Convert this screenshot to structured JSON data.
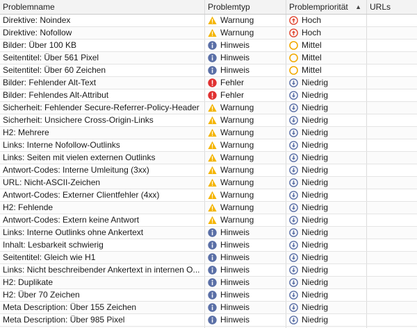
{
  "columns": {
    "name": "Problemname",
    "type": "Problemtyp",
    "priority": "Problempriorität",
    "urls": "URLs"
  },
  "type_icons": {
    "Warnung": "warning-icon",
    "Hinweis": "info-icon",
    "Fehler": "error-icon"
  },
  "priority_icons": {
    "Hoch": "priority-high-icon",
    "Mittel": "priority-medium-icon",
    "Niedrig": "priority-low-icon"
  },
  "colors": {
    "warning": "#f4b400",
    "info": "#5a6fa6",
    "error": "#e03131",
    "priority_high": "#e0452f",
    "priority_medium": "#f2a900",
    "priority_low": "#5a6fa6"
  },
  "rows": [
    {
      "name": "Direktive: Noindex",
      "type": "Warnung",
      "priority": "Hoch",
      "urls": ""
    },
    {
      "name": "Direktive: Nofollow",
      "type": "Warnung",
      "priority": "Hoch",
      "urls": ""
    },
    {
      "name": "Bilder: Über 100 KB",
      "type": "Hinweis",
      "priority": "Mittel",
      "urls": ""
    },
    {
      "name": "Seitentitel: Über 561 Pixel",
      "type": "Hinweis",
      "priority": "Mittel",
      "urls": ""
    },
    {
      "name": "Seitentitel: Über 60 Zeichen",
      "type": "Hinweis",
      "priority": "Mittel",
      "urls": ""
    },
    {
      "name": "Bilder: Fehlender Alt-Text",
      "type": "Fehler",
      "priority": "Niedrig",
      "urls": ""
    },
    {
      "name": "Bilder: Fehlendes Alt-Attribut",
      "type": "Fehler",
      "priority": "Niedrig",
      "urls": ""
    },
    {
      "name": "Sicherheit: Fehlender Secure-Referrer-Policy-Header",
      "type": "Warnung",
      "priority": "Niedrig",
      "urls": ""
    },
    {
      "name": "Sicherheit: Unsichere Cross-Origin-Links",
      "type": "Warnung",
      "priority": "Niedrig",
      "urls": ""
    },
    {
      "name": "H2: Mehrere",
      "type": "Warnung",
      "priority": "Niedrig",
      "urls": ""
    },
    {
      "name": "Links: Interne Nofollow-Outlinks",
      "type": "Warnung",
      "priority": "Niedrig",
      "urls": ""
    },
    {
      "name": "Links: Seiten mit vielen externen Outlinks",
      "type": "Warnung",
      "priority": "Niedrig",
      "urls": ""
    },
    {
      "name": "Antwort-Codes: Interne Umleitung (3xx)",
      "type": "Warnung",
      "priority": "Niedrig",
      "urls": ""
    },
    {
      "name": "URL: Nicht-ASCII-Zeichen",
      "type": "Warnung",
      "priority": "Niedrig",
      "urls": ""
    },
    {
      "name": "Antwort-Codes: Externer Clientfehler (4xx)",
      "type": "Warnung",
      "priority": "Niedrig",
      "urls": ""
    },
    {
      "name": "H2: Fehlende",
      "type": "Warnung",
      "priority": "Niedrig",
      "urls": ""
    },
    {
      "name": "Antwort-Codes: Extern keine Antwort",
      "type": "Warnung",
      "priority": "Niedrig",
      "urls": ""
    },
    {
      "name": "Links: Interne Outlinks ohne Ankertext",
      "type": "Hinweis",
      "priority": "Niedrig",
      "urls": ""
    },
    {
      "name": "Inhalt: Lesbarkeit schwierig",
      "type": "Hinweis",
      "priority": "Niedrig",
      "urls": ""
    },
    {
      "name": "Seitentitel: Gleich wie H1",
      "type": "Hinweis",
      "priority": "Niedrig",
      "urls": ""
    },
    {
      "name": "Links: Nicht beschreibender Ankertext in internen O...",
      "type": "Hinweis",
      "priority": "Niedrig",
      "urls": ""
    },
    {
      "name": "H2: Duplikate",
      "type": "Hinweis",
      "priority": "Niedrig",
      "urls": ""
    },
    {
      "name": "H2: Über 70 Zeichen",
      "type": "Hinweis",
      "priority": "Niedrig",
      "urls": ""
    },
    {
      "name": "Meta Description: Über 155 Zeichen",
      "type": "Hinweis",
      "priority": "Niedrig",
      "urls": ""
    },
    {
      "name": "Meta Description: Über 985 Pixel",
      "type": "Hinweis",
      "priority": "Niedrig",
      "urls": ""
    },
    {
      "name": "",
      "type": "",
      "priority": "",
      "urls": ""
    }
  ]
}
